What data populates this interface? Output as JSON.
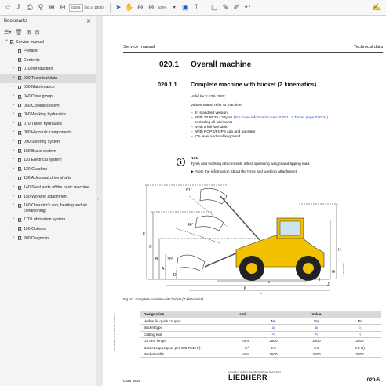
{
  "toolbar": {
    "page_field": "020-5",
    "page_count": "(60 of 1006)",
    "zoom": "100%"
  },
  "sidebar": {
    "title": "Bookmarks",
    "items": [
      {
        "label": "Service manual",
        "level": 0,
        "expanded": true
      },
      {
        "label": "Preface",
        "level": 1,
        "expandable": false
      },
      {
        "label": "Contents",
        "level": 1,
        "expandable": false
      },
      {
        "label": "010 Introduction",
        "level": 1,
        "expandable": true
      },
      {
        "label": "020 Technical data",
        "level": 1,
        "expandable": true,
        "selected": true
      },
      {
        "label": "030 Maintenance",
        "level": 1,
        "expandable": true
      },
      {
        "label": "040 Drive group",
        "level": 1,
        "expandable": true
      },
      {
        "label": "050 Cooling system",
        "level": 1,
        "expandable": true
      },
      {
        "label": "060 Working hydraulics",
        "level": 1,
        "expandable": true
      },
      {
        "label": "070 Travel hydraulics",
        "level": 1,
        "expandable": true
      },
      {
        "label": "080 Hydraulic components",
        "level": 1,
        "expandable": true
      },
      {
        "label": "090 Steering system",
        "level": 1,
        "expandable": true
      },
      {
        "label": "100 Brake system",
        "level": 1,
        "expandable": true
      },
      {
        "label": "110 Electrical system",
        "level": 1,
        "expandable": true
      },
      {
        "label": "120 Gearbox",
        "level": 1,
        "expandable": true
      },
      {
        "label": "130 Axles and drive shafts",
        "level": 1,
        "expandable": true
      },
      {
        "label": "140 Steel parts of the basic machine",
        "level": 1,
        "expandable": true
      },
      {
        "label": "150 Working attachment",
        "level": 1,
        "expandable": true
      },
      {
        "label": "160 Operator's cab, heating and air conditioning",
        "level": 1,
        "expandable": true
      },
      {
        "label": "170 Lubrication system",
        "level": 1,
        "expandable": true
      },
      {
        "label": "190 Options",
        "level": 1,
        "expandable": true
      },
      {
        "label": "200 Diagnosis",
        "level": 1,
        "expandable": true
      }
    ]
  },
  "document": {
    "header_left": "Service manual",
    "header_right": "Technical data",
    "section_num": "020.1",
    "section_title": "Overall machine",
    "subsection_num": "020.1.1",
    "subsection_title": "Complete machine with bucket (Z kinematics)",
    "valid_for": "Valid for: L538-1559;",
    "values_intro": "Values stated refer to machine:",
    "bullets": [
      {
        "text": "In standard version",
        "link": ""
      },
      {
        "text": "With 20.5R25 L3 tyres ",
        "link": "(For more information see: 020.11.4 Tyres, page 020-34)"
      },
      {
        "text": "Including all lubricants",
        "link": ""
      },
      {
        "text": "With a full fuel tank",
        "link": ""
      },
      {
        "text": "With ROPS/FOPS cab and operator",
        "link": ""
      },
      {
        "text": "On level and stable ground",
        "link": ""
      }
    ],
    "note_title": "Note",
    "note_text": "Tyres and working attachments affect operating weight and tipping load.",
    "note_action": "Note the information about the tyres and working attachment.",
    "figure_caption": "Fig. 61: Complete machine with bucket (Z kinematics)",
    "figure_labels": {
      "angle1": "61°",
      "angle2": "46°",
      "angle3": "30°",
      "angle4": "36°"
    },
    "dim_letters": [
      "E",
      "C",
      "B",
      "A",
      "D",
      "H",
      "G",
      "F",
      "L",
      "K",
      "J",
      "I"
    ],
    "side_code": "L60311705",
    "left_code": "LWH 0004890 00-01-2021 EN-20140/Auto",
    "table": {
      "headers": [
        "Designation",
        "Unit",
        "Value"
      ],
      "rows": [
        {
          "designation": "Hydraulic quick coupler",
          "unit": "",
          "values": [
            "No",
            "Yes",
            "No"
          ]
        },
        {
          "designation": "Bucket type",
          "unit": "",
          "values": [
            "A)",
            "B)",
            "C)"
          ]
        },
        {
          "designation": "Cutting tool",
          "unit": "",
          "values": [
            "D)",
            "E)",
            "E)"
          ]
        },
        {
          "designation": "Lift arm length",
          "unit": "mm",
          "values": [
            "2500",
            "2500",
            "2500"
          ]
        },
        {
          "designation": "Bucket capacity as per ISO 7546 F)",
          "unit": "m³",
          "values": [
            "2.6",
            "2.3",
            "2.8 G)"
          ]
        },
        {
          "designation": "Bucket width",
          "unit": "mm",
          "values": [
            "2500",
            "2500",
            "2500"
          ]
        }
      ]
    },
    "footer_copyright": "copyright © Liebherr-Werk Bischofshofen GmbH 2021",
    "footer_brand": "LIEBHERR",
    "footer_left": "L538-1559",
    "footer_page": "020-5"
  }
}
